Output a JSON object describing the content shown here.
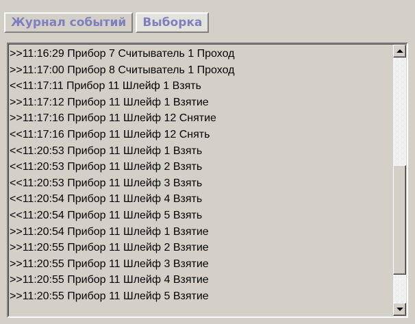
{
  "tabs": [
    {
      "label": "Журнал событий",
      "active": true
    },
    {
      "label": "Выборка",
      "active": false
    }
  ],
  "event_log": {
    "rows": [
      ">>11:16:29 Прибор 7 Считыватель 1 Проход",
      ">>11:17:00 Прибор 8 Считыватель 1 Проход",
      "<<11:17:11 Прибор 11 Шлейф 1 Взять",
      ">>11:17:12 Прибор 11 Шлейф 1 Взятие",
      ">>11:17:16 Прибор 11 Шлейф 12 Снятие",
      "<<11:17:16 Прибор 11 Шлейф 12 Снять",
      "<<11:20:53 Прибор 11 Шлейф 1 Взять",
      "<<11:20:53 Прибор 11 Шлейф 2 Взять",
      "<<11:20:53 Прибор 11 Шлейф 3 Взять",
      "<<11:20:54 Прибор 11 Шлейф 4 Взять",
      "<<11:20:54 Прибор 11 Шлейф 5 Взять",
      ">>11:20:54 Прибор 11 Шлейф 1 Взятие",
      ">>11:20:55 Прибор 11 Шлейф 2 Взятие",
      ">>11:20:55 Прибор 11 Шлейф 3 Взятие",
      ">>11:20:55 Прибор 11 Шлейф 4 Взятие",
      ">>11:20:55 Прибор 11 Шлейф 5 Взятие"
    ]
  },
  "scrollbar": {
    "up_icon": "arrow-up-icon",
    "down_icon": "arrow-down-icon",
    "scroll_position": 0.5
  },
  "colors": {
    "tab_text": "#7f7fbf",
    "window_bg": "#d4d0c8"
  }
}
